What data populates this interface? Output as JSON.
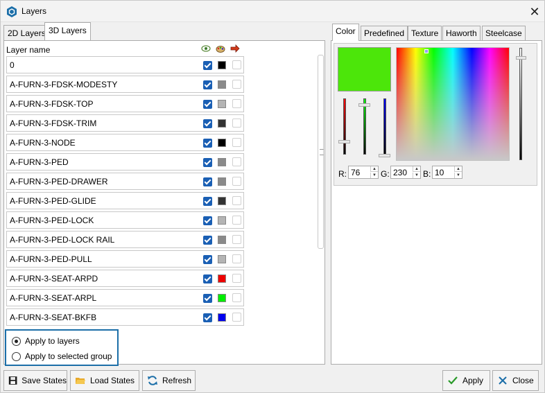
{
  "window": {
    "title": "Layers",
    "close_glyph": "✕"
  },
  "left_tabs": [
    {
      "label": "2D Layers"
    },
    {
      "label": "3D Layers",
      "active": true
    }
  ],
  "layer_table": {
    "header_name": "Layer name",
    "header_icons": [
      "visibility-icon",
      "color-palette-icon",
      "arrow-export-icon"
    ],
    "rows": [
      {
        "name": "0",
        "visible": true,
        "color": "#000000"
      },
      {
        "name": "A-FURN-3-FDSK-MODESTY",
        "visible": true,
        "color": "#8a8a8a"
      },
      {
        "name": "A-FURN-3-FDSK-TOP",
        "visible": true,
        "color": "#b4b4b4"
      },
      {
        "name": "A-FURN-3-FDSK-TRIM",
        "visible": true,
        "color": "#333333"
      },
      {
        "name": "A-FURN-3-NODE",
        "visible": true,
        "color": "#000000"
      },
      {
        "name": "A-FURN-3-PED",
        "visible": true,
        "color": "#8a8a8a"
      },
      {
        "name": "A-FURN-3-PED-DRAWER",
        "visible": true,
        "color": "#8a8a8a"
      },
      {
        "name": "A-FURN-3-PED-GLIDE",
        "visible": true,
        "color": "#333333"
      },
      {
        "name": "A-FURN-3-PED-LOCK",
        "visible": true,
        "color": "#b4b4b4"
      },
      {
        "name": "A-FURN-3-PED-LOCK RAIL",
        "visible": true,
        "color": "#8a8a8a"
      },
      {
        "name": "A-FURN-3-PED-PULL",
        "visible": true,
        "color": "#b4b4b4"
      },
      {
        "name": "A-FURN-3-SEAT-ARPD",
        "visible": true,
        "color": "#ee0000"
      },
      {
        "name": "A-FURN-3-SEAT-ARPL",
        "visible": true,
        "color": "#00ee00"
      },
      {
        "name": "A-FURN-3-SEAT-BKFB",
        "visible": true,
        "color": "#0000ee"
      }
    ]
  },
  "apply_options": [
    {
      "label": "Apply to layers",
      "selected": true
    },
    {
      "label": "Apply to selected group",
      "selected": false
    }
  ],
  "right_tabs": [
    {
      "label": "Color",
      "active": true
    },
    {
      "label": "Predefined"
    },
    {
      "label": "Texture"
    },
    {
      "label": "Haworth"
    },
    {
      "label": "Steelcase"
    }
  ],
  "color_picker": {
    "preview_color": "#4ce60a",
    "r_label": "R:",
    "r": "76",
    "g_label": "G:",
    "g": "230",
    "b_label": "B:",
    "b": "10"
  },
  "buttons": {
    "save_states": "Save States",
    "load_states": "Load States",
    "refresh": "Refresh",
    "apply": "Apply",
    "close": "Close"
  }
}
